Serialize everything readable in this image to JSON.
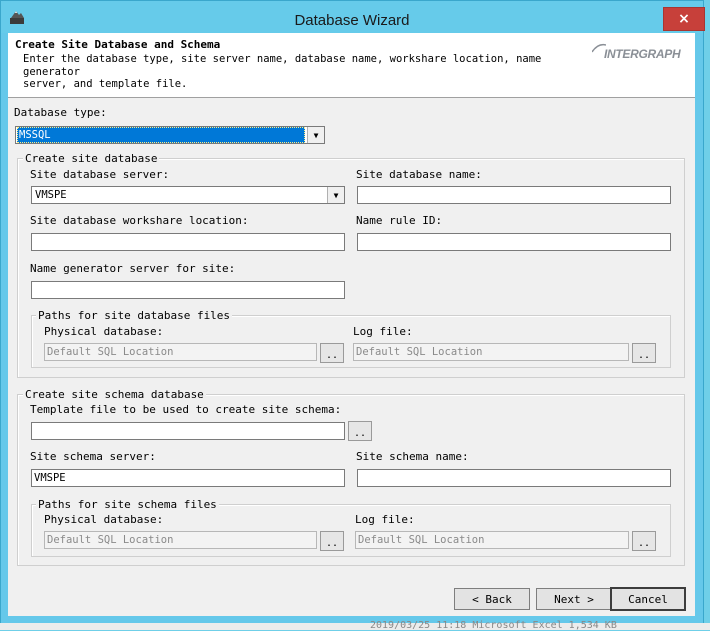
{
  "window": {
    "title": "Database Wizard",
    "close_icon": "×"
  },
  "header": {
    "title": "Create Site Database and Schema",
    "description": "Enter the database type, site server name, database name, workshare location, name generator\nserver, and template file.",
    "logo_text": "INTERGRAPH"
  },
  "database_type": {
    "label": "Database type:",
    "value": "MSSQL"
  },
  "site_db": {
    "group_label": "Create site database",
    "server_label": "Site database server:",
    "server_value": "VMSPE",
    "name_label": "Site database name:",
    "name_value": "",
    "workshare_label": "Site database workshare location:",
    "workshare_value": "",
    "namerule_label": "Name rule ID:",
    "namerule_value": "",
    "namegen_label": "Name generator server for site:",
    "namegen_value": "",
    "paths_group_label": "Paths for site database files",
    "physical_label": "Physical database:",
    "physical_value": "Default SQL Location",
    "log_label": "Log file:",
    "log_value": "Default SQL Location",
    "browse": ".."
  },
  "schema_db": {
    "group_label": "Create site schema database",
    "template_label": "Template file to be used to create site schema:",
    "template_value": "",
    "server_label": "Site schema server:",
    "server_value": "VMSPE",
    "name_label": "Site schema name:",
    "name_value": "",
    "paths_group_label": "Paths for site schema files",
    "physical_label": "Physical database:",
    "physical_value": "Default SQL Location",
    "log_label": "Log file:",
    "log_value": "Default SQL Location",
    "browse": ".."
  },
  "buttons": {
    "back": "< Back",
    "next": "Next >",
    "cancel": "Cancel"
  },
  "background": {
    "text": "2019/03/25 11:18     Microsoft Excel      1,534 KB"
  },
  "colors": {
    "titlebar": "#66cbea",
    "close": "#c7403a",
    "selection": "#0078d7"
  }
}
